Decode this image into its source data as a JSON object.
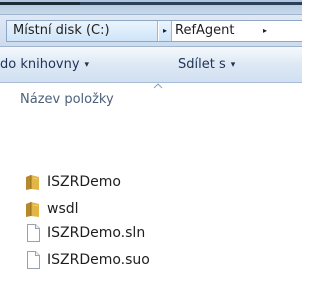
{
  "address_bar": {
    "crumbs": [
      {
        "label": "Místní disk (C:)"
      },
      {
        "label": "RefAgent"
      }
    ],
    "separator_glyph": "▸"
  },
  "toolbar": {
    "library_label": "do knihovny",
    "share_label": "Sdílet s",
    "dropdown_glyph": "▾"
  },
  "file_list": {
    "column_header": "Název položky",
    "sort_direction": "ascending",
    "items": [
      {
        "name": "ISZRDemo",
        "icon": "folder-icon"
      },
      {
        "name": "wsdl",
        "icon": "folder-icon"
      },
      {
        "name": "ISZRDemo.sln",
        "icon": "document-icon"
      },
      {
        "name": "ISZRDemo.suo",
        "icon": "document-icon"
      }
    ]
  },
  "colors": {
    "folder": "#e2b547",
    "folder_dark": "#b8892a",
    "header_text": "#4c607a",
    "toolbar_text": "#1e3355"
  }
}
